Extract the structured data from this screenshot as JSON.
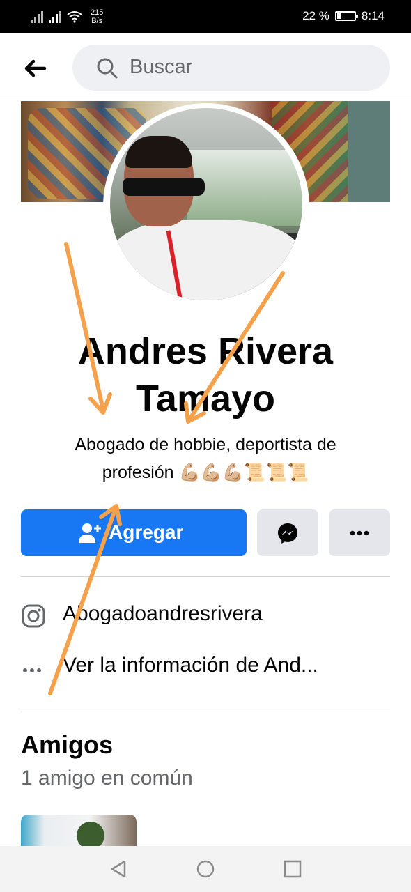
{
  "status_bar": {
    "network_speed_value": "215",
    "network_speed_unit": "B/s",
    "battery_text": "22 %",
    "battery_level": 0.22,
    "time": "8:14"
  },
  "search": {
    "placeholder": "Buscar"
  },
  "profile": {
    "name_line1": "Andres Rivera",
    "name_line2": "Tamayo",
    "bio_line1": "Abogado de hobbie, deportista de",
    "bio_line2": "profesión 💪🏼💪🏼💪🏼📜📜📜"
  },
  "actions": {
    "add_label": "Agregar"
  },
  "info": {
    "instagram": "Abogadoandresrivera",
    "more_info": "Ver la información de And..."
  },
  "friends": {
    "title": "Amigos",
    "mutual": "1 amigo en común"
  },
  "colors": {
    "primary_blue": "#1877f2",
    "secondary_bg": "#e4e6eb",
    "annotation_arrow": "#f5a04a"
  },
  "icons": [
    "back-arrow-icon",
    "search-icon",
    "add-friend-icon",
    "messenger-icon",
    "more-icon",
    "instagram-icon",
    "ellipsis-icon",
    "nav-back-icon",
    "nav-home-icon",
    "nav-recent-icon"
  ]
}
